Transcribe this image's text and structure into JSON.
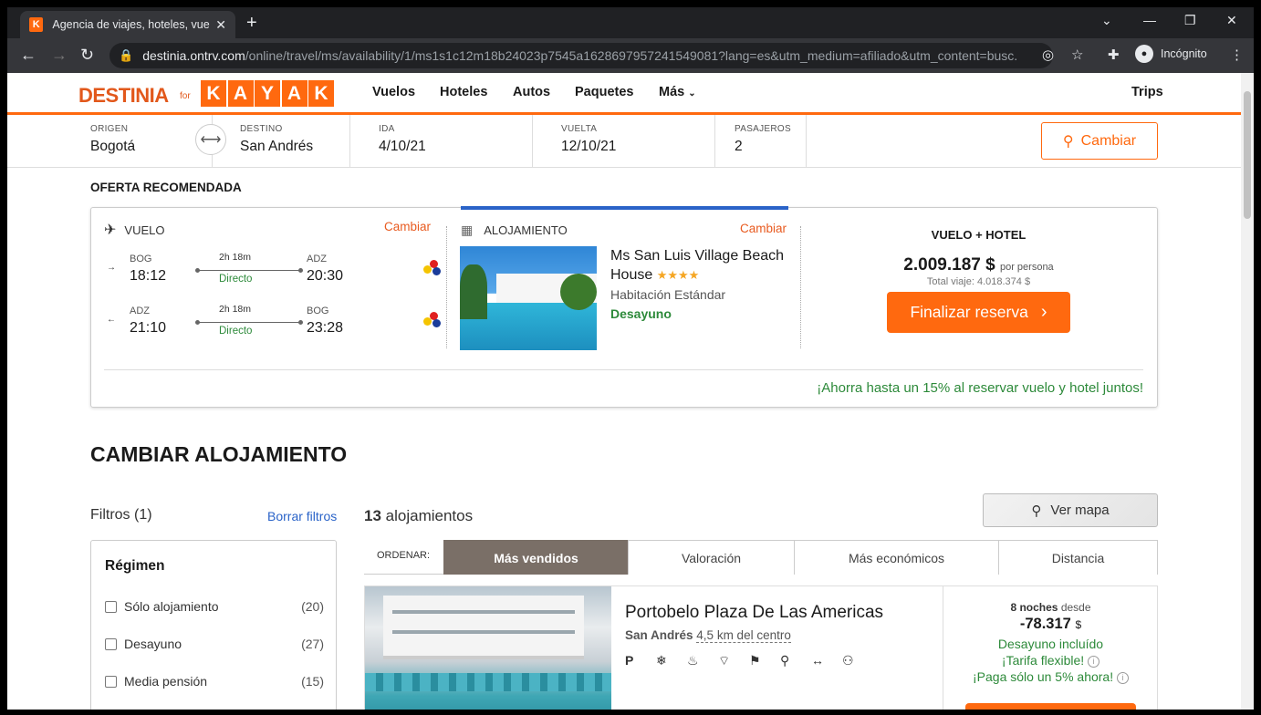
{
  "browser": {
    "tab_title": "Agencia de viajes, hoteles, vuelos",
    "tab_icon_letter": "K",
    "url_domain": "destinia.ontrv.com",
    "url_path": "/online/travel/ms/availability/1/ms1s1c12m18b24023p7545a1628697957241549081?lang=es&utm_medium=afiliado&utm_content=busc...",
    "profile_label": "Incógnito"
  },
  "header": {
    "logo": "DESTINIA",
    "logo_for": "for",
    "kayak_letters": [
      "K",
      "A",
      "Y",
      "A",
      "K"
    ],
    "nav": [
      "Vuelos",
      "Hoteles",
      "Autos",
      "Paquetes",
      "Más"
    ],
    "trips": "Trips"
  },
  "search": {
    "origin_label": "ORIGEN",
    "origin": "Bogotá",
    "dest_label": "DESTINO",
    "dest": "San Andrés",
    "ida_label": "IDA",
    "ida": "4/10/21",
    "vuelta_label": "VUELTA",
    "vuelta": "12/10/21",
    "pax_label": "PASAJEROS",
    "pax": "2",
    "change_btn": "Cambiar"
  },
  "offer": {
    "section_title": "OFERTA RECOMENDADA",
    "flight_label": "VUELO",
    "change": "Cambiar",
    "outbound": {
      "from": "BOG",
      "dep": "18:12",
      "duration": "2h 18m",
      "type": "Directo",
      "to": "ADZ",
      "arr": "20:30"
    },
    "inbound": {
      "from": "ADZ",
      "dep": "21:10",
      "duration": "2h 18m",
      "type": "Directo",
      "to": "BOG",
      "arr": "23:28"
    },
    "hotel_label": "ALOJAMIENTO",
    "hotel_name": "Ms San Luis Village Beach House",
    "hotel_stars": "★★★★",
    "room": "Habitación Estándar",
    "board": "Desayuno",
    "package_title": "VUELO + HOTEL",
    "price": "2.009.187",
    "currency": "$",
    "per_person": "por persona",
    "total": "Total viaje: 4.018.374 $",
    "book_btn": "Finalizar reserva",
    "savings": "¡Ahorra hasta un 15% al reservar vuelo y hotel juntos!"
  },
  "change_lodging": {
    "title": "CAMBIAR ALOJAMIENTO",
    "filters_title": "Filtros (1)",
    "clear_filters": "Borrar filtros",
    "count": "13",
    "count_label": "alojamientos",
    "map_btn": "Ver mapa",
    "regimen_title": "Régimen",
    "regimen": [
      {
        "label": "Sólo alojamiento",
        "count": "(20)"
      },
      {
        "label": "Desayuno",
        "count": "(27)"
      },
      {
        "label": "Media pensión",
        "count": "(15)"
      }
    ],
    "sort_label": "ORDENAR:",
    "sort_tabs": [
      "Más vendidos",
      "Valoración",
      "Más económicos",
      "Distancia"
    ]
  },
  "result": {
    "name": "Portobelo Plaza De Las Americas",
    "city": "San Andrés",
    "distance": "4,5 km del centro",
    "amenities": [
      "P",
      "❄",
      "♨",
      "⌔",
      "⚑",
      "⚲",
      "↔",
      "⚇"
    ],
    "nights": "8 noches",
    "from": "desde",
    "price": "-78.317",
    "currency": "$",
    "breakfast": "Desayuno incluído",
    "flexible": "¡Tarifa flexible!",
    "pay": "¡Paga sólo un 5% ahora!"
  }
}
